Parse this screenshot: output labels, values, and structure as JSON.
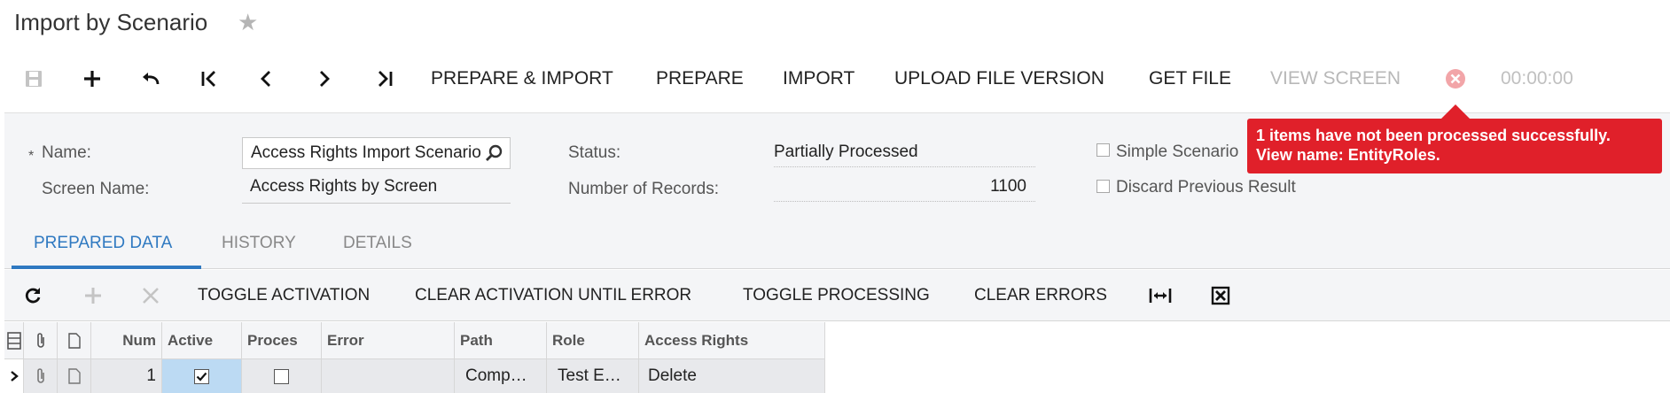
{
  "header": {
    "title": "Import by Scenario"
  },
  "toolbar": {
    "prepare_import": "PREPARE & IMPORT",
    "prepare": "PREPARE",
    "import": "IMPORT",
    "upload_file_version": "UPLOAD FILE VERSION",
    "get_file": "GET FILE",
    "view_screen": "VIEW SCREEN",
    "timer": "00:00:00"
  },
  "form": {
    "name_label": "Name:",
    "name_value": "Access Rights Import Scenario",
    "screen_name_label": "Screen Name:",
    "screen_name_value": "Access Rights by Screen",
    "status_label": "Status:",
    "status_value": "Partially Processed",
    "records_label": "Number of Records:",
    "records_value": "1100",
    "simple_scenario_label": "Simple Scenario",
    "discard_label": "Discard Previous Result"
  },
  "error_tooltip": {
    "line1": "1 items have not been processed successfully.",
    "line2": "View name: EntityRoles."
  },
  "tabs": [
    {
      "label": "PREPARED DATA",
      "active": true
    },
    {
      "label": "HISTORY",
      "active": false
    },
    {
      "label": "DETAILS",
      "active": false
    }
  ],
  "grid_toolbar": {
    "toggle_activation": "TOGGLE ACTIVATION",
    "clear_activation": "CLEAR ACTIVATION UNTIL ERROR",
    "toggle_processing": "TOGGLE PROCESSING",
    "clear_errors": "CLEAR ERRORS"
  },
  "grid": {
    "columns": [
      "Num",
      "Active",
      "Proces",
      "Error",
      "Path",
      "Role",
      "Access Rights"
    ],
    "rows": [
      {
        "num": "1",
        "active": true,
        "processed": false,
        "error": "",
        "path": "Comp…",
        "role": "Test E…",
        "access_rights": "Delete"
      }
    ]
  },
  "colors": {
    "accent": "#2f79c1",
    "error": "#e0202a",
    "panel": "#f4f5f7"
  }
}
